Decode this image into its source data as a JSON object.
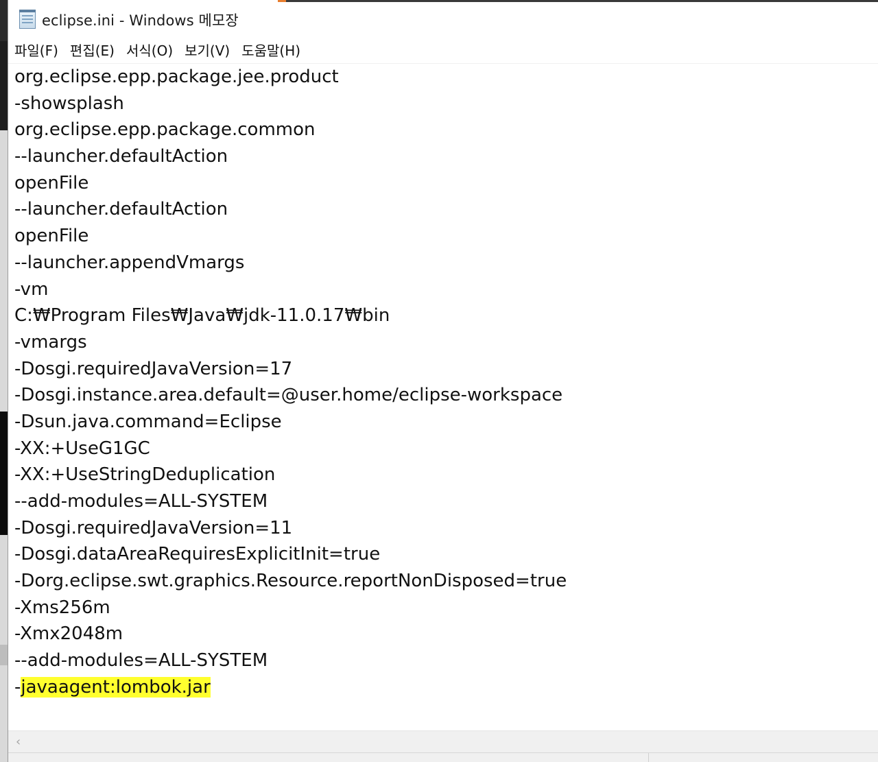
{
  "window": {
    "title": "eclipse.ini - Windows 메모장",
    "icon": "notepad-icon"
  },
  "menu": [
    {
      "id": "file",
      "label": "파일(F)"
    },
    {
      "id": "edit",
      "label": "편집(E)"
    },
    {
      "id": "format",
      "label": "서식(O)"
    },
    {
      "id": "view",
      "label": "보기(V)"
    },
    {
      "id": "help",
      "label": "도움말(H)"
    }
  ],
  "editor": {
    "lines": [
      "org.eclipse.epp.package.jee.product",
      "-showsplash",
      "org.eclipse.epp.package.common",
      "--launcher.defaultAction",
      "openFile",
      "--launcher.defaultAction",
      "openFile",
      "--launcher.appendVmargs",
      "-vm",
      "C:₩Program Files₩Java₩jdk-11.0.17₩bin",
      "-vmargs",
      "-Dosgi.requiredJavaVersion=17",
      "-Dosgi.instance.area.default=@user.home/eclipse-workspace",
      "-Dsun.java.command=Eclipse",
      "-XX:+UseG1GC",
      "-XX:+UseStringDeduplication",
      "--add-modules=ALL-SYSTEM",
      "-Dosgi.requiredJavaVersion=11",
      "-Dosgi.dataAreaRequiresExplicitInit=true",
      "-Dorg.eclipse.swt.graphics.Resource.reportNonDisposed=true",
      "-Xms256m",
      "-Xmx2048m",
      "--add-modules=ALL-SYSTEM"
    ],
    "last_line_prefix": "-",
    "last_line_highlighted": "javaagent:lombok.jar",
    "highlight_color": "#ffff2e"
  },
  "scrollbar": {
    "left_arrow": "‹"
  }
}
